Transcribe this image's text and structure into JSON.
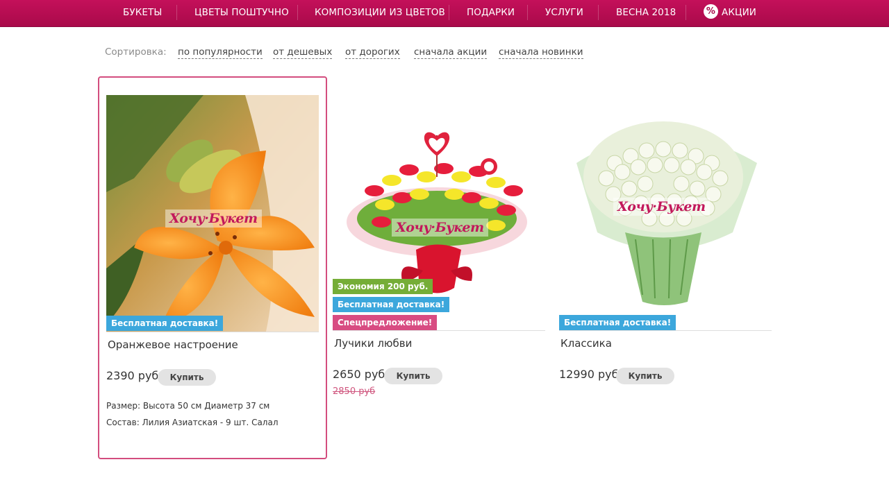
{
  "nav": {
    "items": [
      {
        "label": "БУКЕТЫ"
      },
      {
        "label": "ЦВЕТЫ ПОШТУЧНО"
      },
      {
        "label": "КОМПОЗИЦИИ ИЗ ЦВЕТОВ"
      },
      {
        "label": "ПОДАРКИ"
      },
      {
        "label": "УСЛУГИ"
      },
      {
        "label": "ВЕСНА 2018"
      },
      {
        "label": "АКЦИИ",
        "icon": "percent-icon"
      }
    ]
  },
  "sort": {
    "label": "Сортировка:",
    "options": [
      "по популярности",
      "от дешевых",
      "от дорогих",
      "сначала акции",
      "сначала новинки"
    ]
  },
  "products": [
    {
      "name": "Оранжевое настроение",
      "price": "2390 руб",
      "buy_label": "Купить",
      "watermark": "Хочу·Букет",
      "badges": [
        "Бесплатная доставка!"
      ],
      "size": "Размер: Высота 50 см Диаметр 37 см",
      "composition": "Состав: Лилия Азиатская - 9 шт. Салал"
    },
    {
      "name": "Лучики любви",
      "price": "2650 руб",
      "old_price": "2850 руб",
      "buy_label": "Купить",
      "watermark": "Хочу·Букет",
      "badges": [
        "Экономия 200 руб.",
        "Бесплатная доставка!",
        "Спецпредложение!"
      ]
    },
    {
      "name": "Классика",
      "price": "12990 руб",
      "buy_label": "Купить",
      "watermark": "Хочу·Букет",
      "badges": [
        "Бесплатная доставка!"
      ]
    }
  ],
  "colors": {
    "nav_bg": "#b30d50",
    "card_border": "#d34d7e",
    "badge_blue": "#3ca7dc",
    "badge_green": "#75ad37",
    "badge_pink": "#d84c82",
    "old_price": "#d0577f"
  }
}
